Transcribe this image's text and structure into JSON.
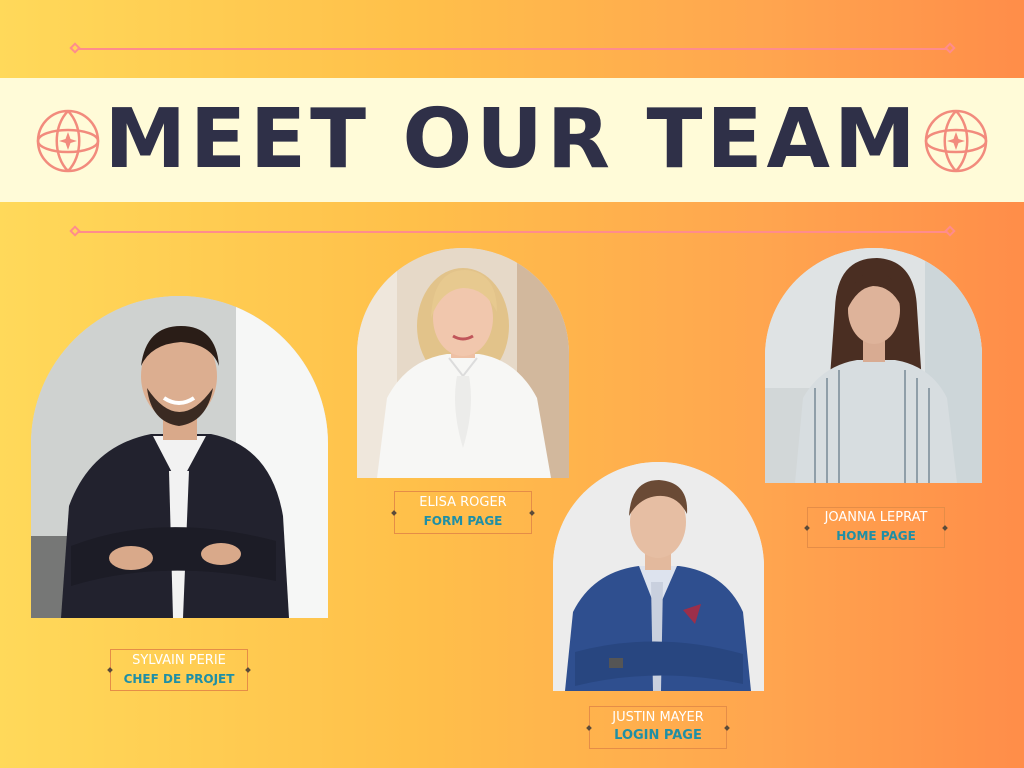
{
  "title": "MEET OUR TEAM",
  "team": [
    {
      "name": "SYLVAIN PERIE",
      "role": "CHEF DE PROJET"
    },
    {
      "name": "ELISA ROGER",
      "role": "FORM PAGE"
    },
    {
      "name": "JUSTIN MAYER",
      "role": "LOGIN PAGE"
    },
    {
      "name": "JOANNA LEPRAT",
      "role": "HOME PAGE"
    }
  ],
  "colors": {
    "background_start": "#ffd95a",
    "background_end": "#ff8d49",
    "title_band": "#fffbd8",
    "title_text": "#2f3048",
    "accent_pink": "#ff8c8c",
    "name_text": "#ffffff",
    "role_text": "#1f8fa5"
  }
}
